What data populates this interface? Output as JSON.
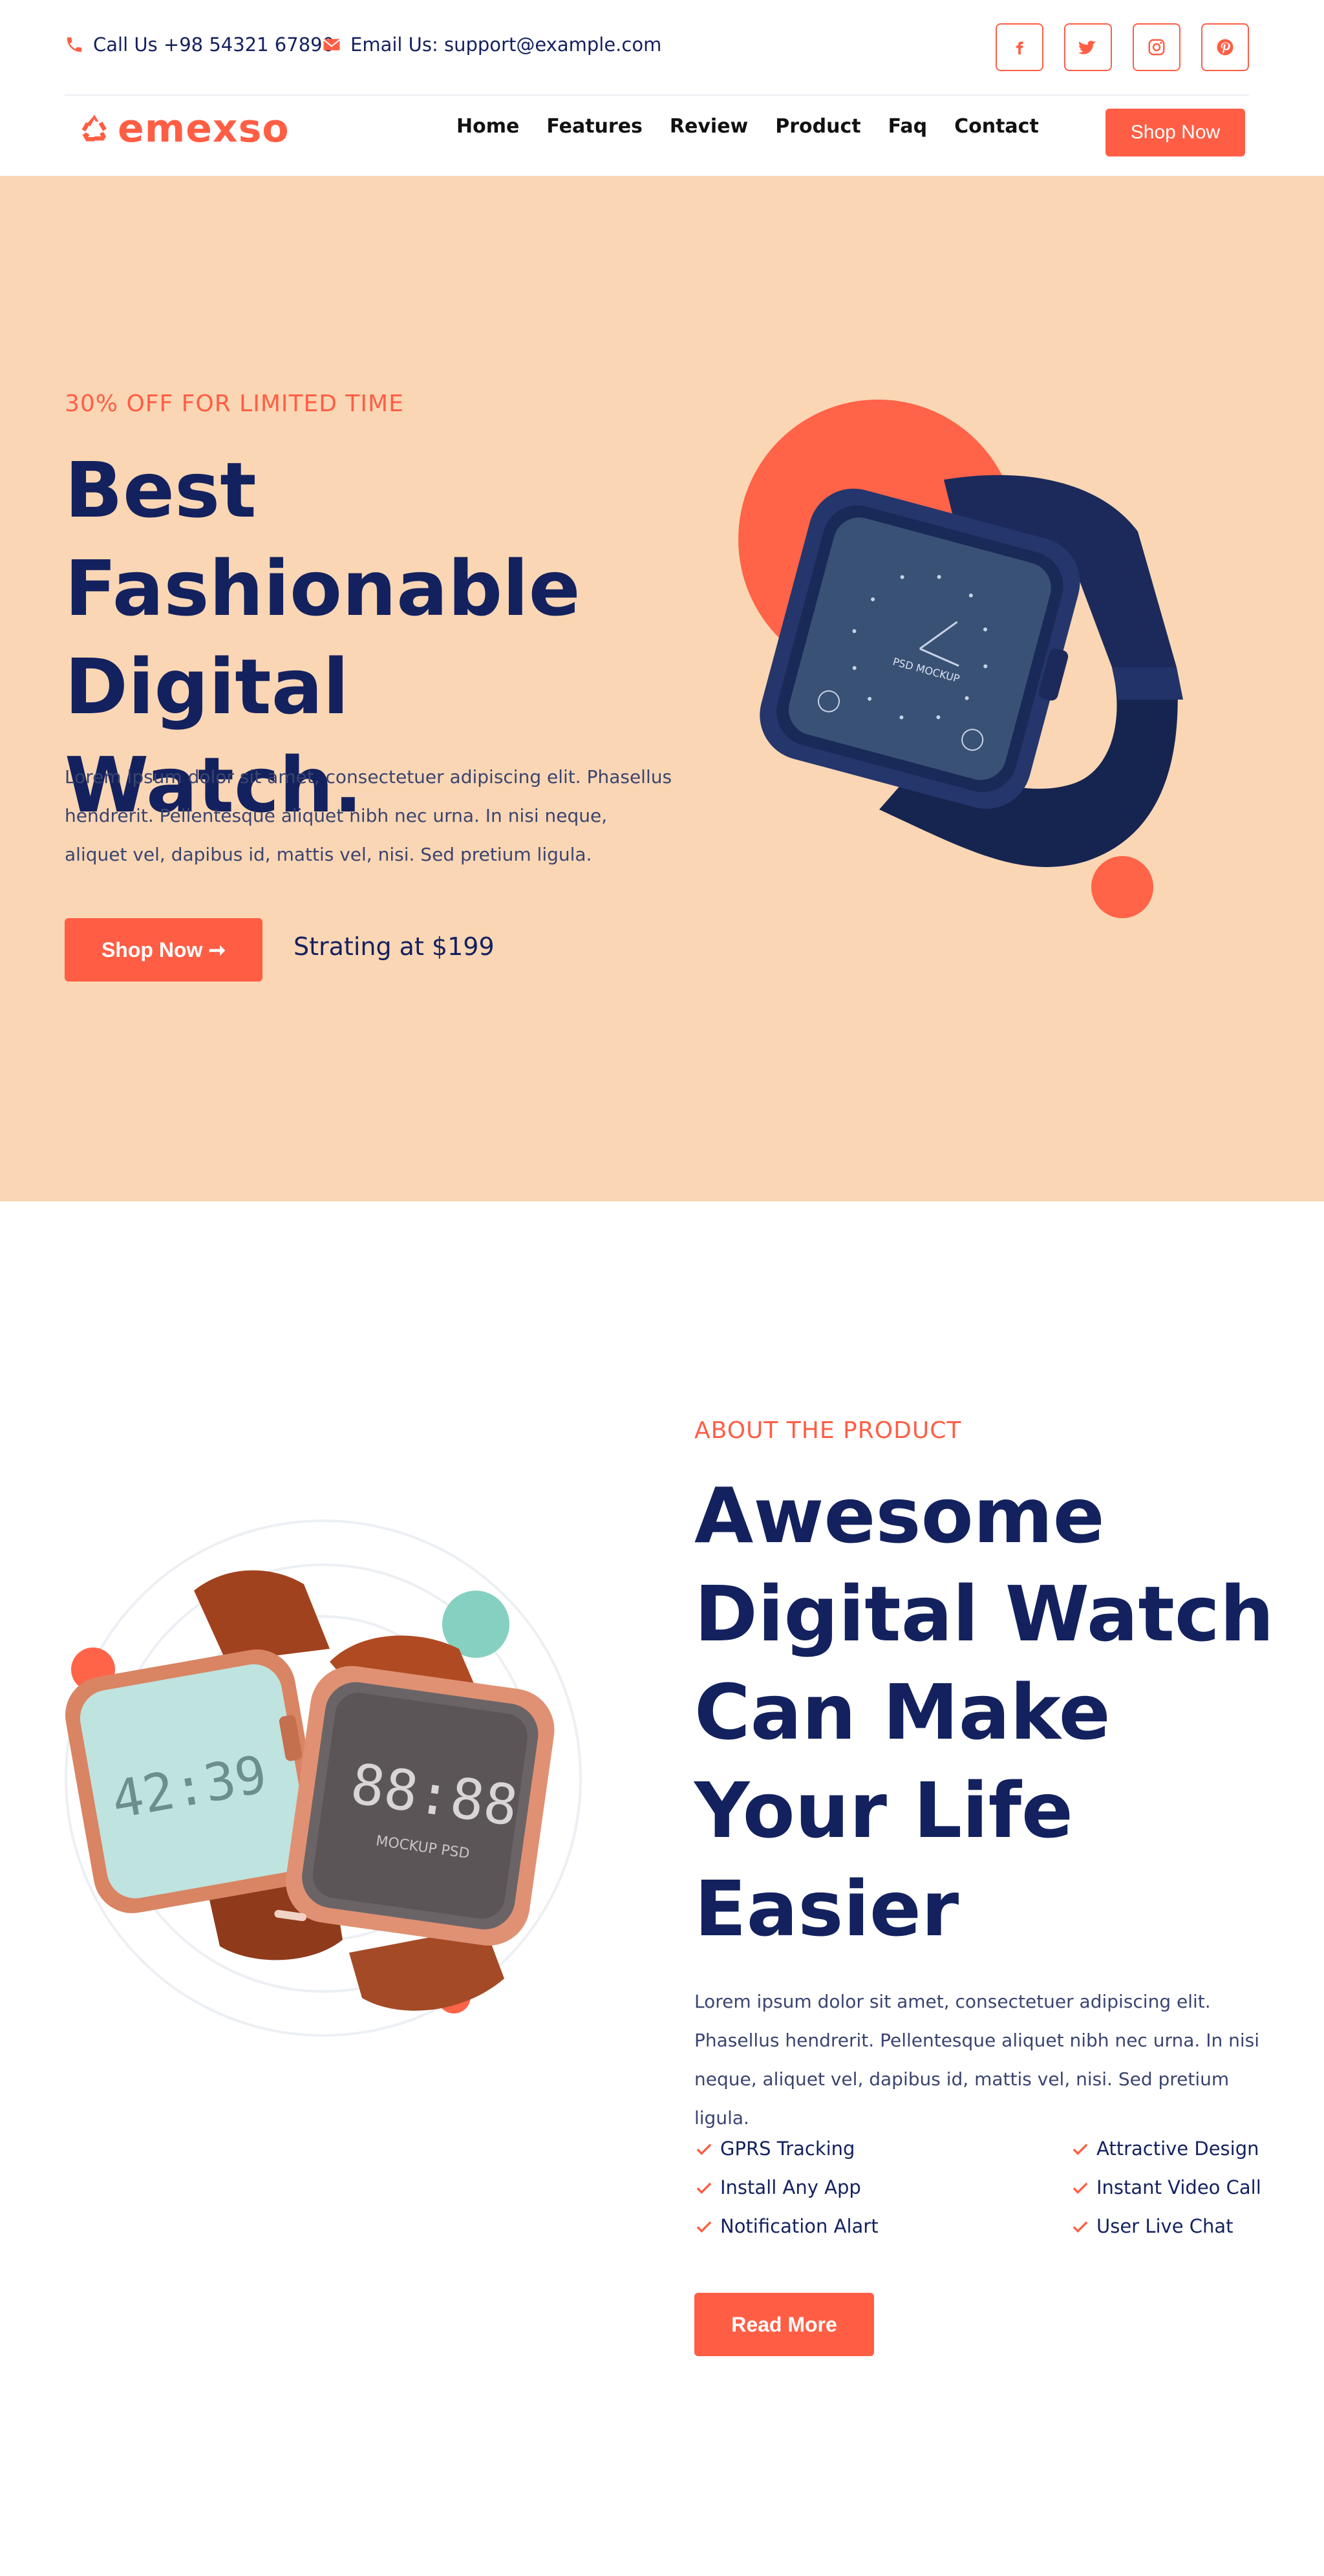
{
  "topbar": {
    "phone": "Call Us +98 54321 67890",
    "email": "Email Us: support@example.com",
    "social": [
      "facebook-icon",
      "twitter-icon",
      "instagram-icon",
      "pinterest-icon"
    ]
  },
  "header": {
    "logo": "emexso",
    "nav": [
      "Home",
      "Features",
      "Review",
      "Product",
      "Faq",
      "Contact"
    ],
    "cta": "Shop Now"
  },
  "hero": {
    "eyebrow": "30% OFF FOR LIMITED TIME",
    "title": "Best Fashionable Digital Watch.",
    "description": "Lorem ipsum dolor sit amet, consectetuer adipiscing elit. Phasellus hendrerit. Pellentesque aliquet nibh nec urna. In nisi neque, aliquet vel, dapibus id, mattis vel, nisi. Sed pretium ligula.",
    "button": "Shop Now ➞",
    "price": "Strating at $199",
    "watch_label": "PSD MOCKUP"
  },
  "about": {
    "eyebrow": "ABOUT THE PRODUCT",
    "title": "Awesome Digital Watch Can Make Your Life Easier",
    "description": "Lorem ipsum dolor sit amet, consectetuer adipiscing elit. Phasellus hendrerit. Pellentesque aliquet nibh nec urna. In nisi neque, aliquet vel, dapibus id, mattis vel, nisi. Sed pretium ligula.",
    "features": [
      "GPRS Tracking",
      "Install Any App",
      "Notification Alart",
      "Attractive Design",
      "Instant Video Call",
      "User Live Chat"
    ],
    "button": "Read More",
    "watch_left_time": "42:39",
    "watch_right_time": "88:88",
    "watch_right_label": "MOCKUP PSD"
  },
  "colors": {
    "accent": "#ff5e45",
    "navy": "#13215e",
    "hero_bg": "#fad6b4",
    "teal": "#86d0c1"
  }
}
